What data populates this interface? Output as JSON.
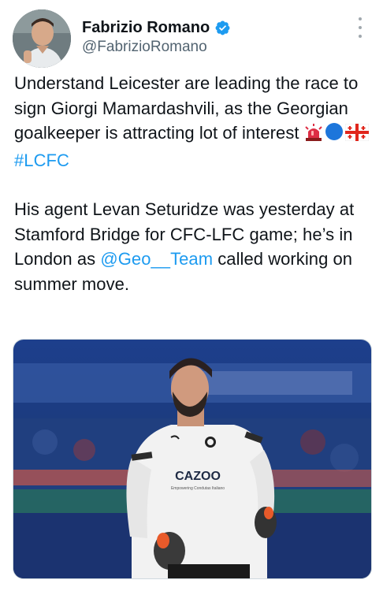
{
  "author": {
    "display_name": "Fabrizio Romano",
    "handle": "@FabrizioRomano",
    "verified_icon": "verified-badge-icon"
  },
  "tweet": {
    "p1_text": "Understand Leicester are leading the race to sign Giorgi Mamardashvili, as the Georgian goalkeeper is attracting lot of interest",
    "p1_emojis": [
      "siren-emoji",
      "blue-circle-emoji",
      "georgia-flag-emoji"
    ],
    "hashtag": "#LCFC",
    "p2_before_mention": "His agent Levan Seturidze was yesterday at Stamford Bridge for CFC-LFC game; he’s in London as",
    "mention": "@Geo__Team",
    "p2_after_mention": "called working on summer move."
  },
  "media": {
    "shirt_sponsor": "CAZOO",
    "shirt_subtext": "Empowering Condutas Italiano"
  },
  "colors": {
    "link": "#1d9bf0",
    "text": "#0f1419",
    "secondary": "#536471"
  }
}
